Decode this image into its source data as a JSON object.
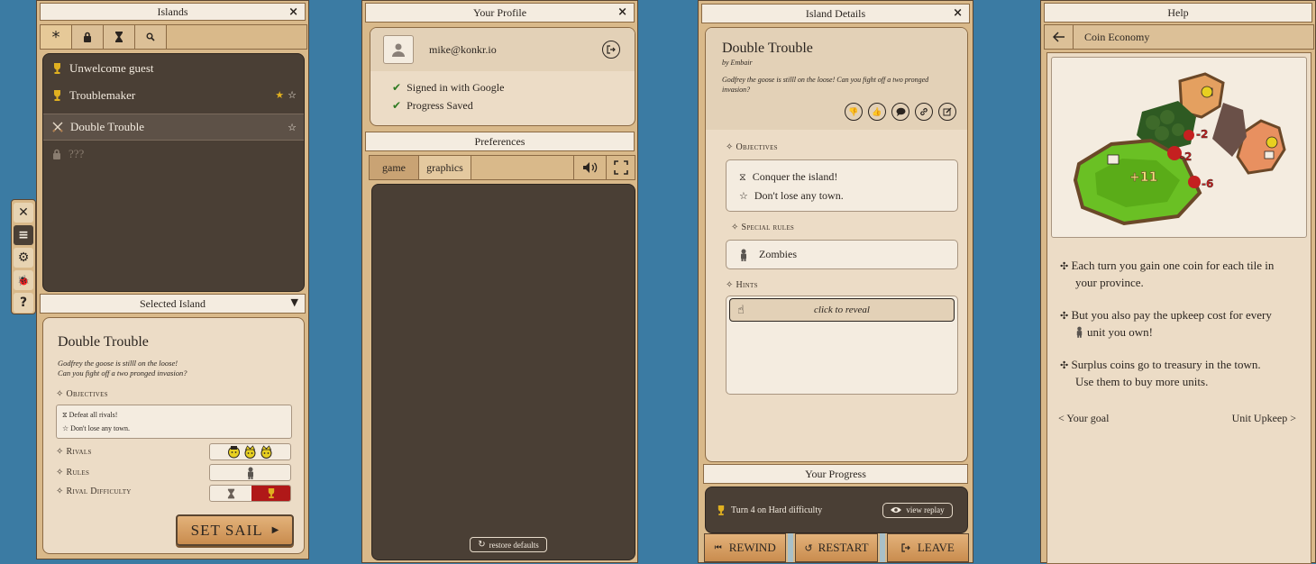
{
  "islands_panel": {
    "title": "Islands",
    "list": [
      {
        "label": "Unwelcome guest"
      },
      {
        "label": "Troublemaker"
      },
      {
        "label": "Double Trouble"
      },
      {
        "label": "???"
      }
    ],
    "selected_title": "Selected Island",
    "selected": {
      "name": "Double Trouble",
      "description_line1": "Godfrey the goose is stilll on the loose!",
      "description_line2": "Can you fight off a two pronged invasion?",
      "objectives_label": "Objectives",
      "objectives": [
        "Defeat all rivals!",
        "Don't lose any town."
      ],
      "rivals_label": "Rivals",
      "rules_label": "Rules",
      "difficulty_label": "Rival Difficulty",
      "set_sail": "SET SAIL"
    }
  },
  "profile_panel": {
    "title": "Your Profile",
    "email": "mike@konkr.io",
    "status": [
      "Signed in with Google",
      "Progress Saved"
    ],
    "preferences_title": "Preferences",
    "tabs": [
      "game",
      "graphics"
    ],
    "restore": "restore defaults"
  },
  "details_panel": {
    "title": "Island Details",
    "name": "Double Trouble",
    "author": "by Embair",
    "description": "Godfrey the goose is stilll on the loose! Can you fight off a two pronged invasion?",
    "objectives_label": "Objectives",
    "objectives": [
      "Conquer the island!",
      "Don't lose any town."
    ],
    "special_rules_label": "Special rules",
    "special_rules": [
      "Zombies"
    ],
    "hints_label": "Hints",
    "reveal": "click to reveal",
    "progress_title": "Your Progress",
    "progress_text": "Turn 4 on Hard difficulty",
    "view_replay": "view replay",
    "buttons": [
      "REWIND",
      "RESTART",
      "LEAVE"
    ]
  },
  "help_panel": {
    "title": "Help",
    "topic": "Coin Economy",
    "map_labels": [
      "+11",
      "-2",
      "-2",
      "-6"
    ],
    "paragraphs": [
      {
        "a": "Each turn you gain one coin for each tile in",
        "b": "your province."
      },
      {
        "a": "But you also pay the upkeep cost for every",
        "b": "unit you own!"
      },
      {
        "a": "Surplus coins go to treasury in the town.",
        "b": "Use them to buy more units."
      }
    ],
    "prev": "< Your goal",
    "next": "Unit Upkeep >"
  },
  "colors": {
    "water": "#3b7ba3",
    "wood": "#d9b98a",
    "parchment": "#ecdcc6",
    "dark": "#4a3f35",
    "trophy": "#e0b020",
    "hard": "#b01818"
  }
}
